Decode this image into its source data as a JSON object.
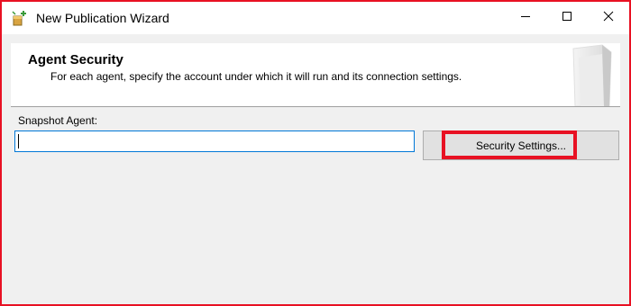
{
  "window": {
    "title": "New Publication Wizard",
    "app_icon": "wizard-package-icon",
    "frame_color": "#e81123"
  },
  "titlebar_buttons": {
    "minimize_icon": "minimize-icon",
    "maximize_icon": "maximize-icon",
    "close_icon": "close-icon"
  },
  "header": {
    "title": "Agent Security",
    "subtitle": "For each agent, specify the account under which it will run and its connection settings.",
    "art_icon": "wizard-header-graphic"
  },
  "snapshot_agent": {
    "label": "Snapshot Agent:",
    "value": "",
    "button_label": "Security Settings..."
  },
  "highlight": {
    "color": "#e81123",
    "target": "security-settings-button"
  }
}
